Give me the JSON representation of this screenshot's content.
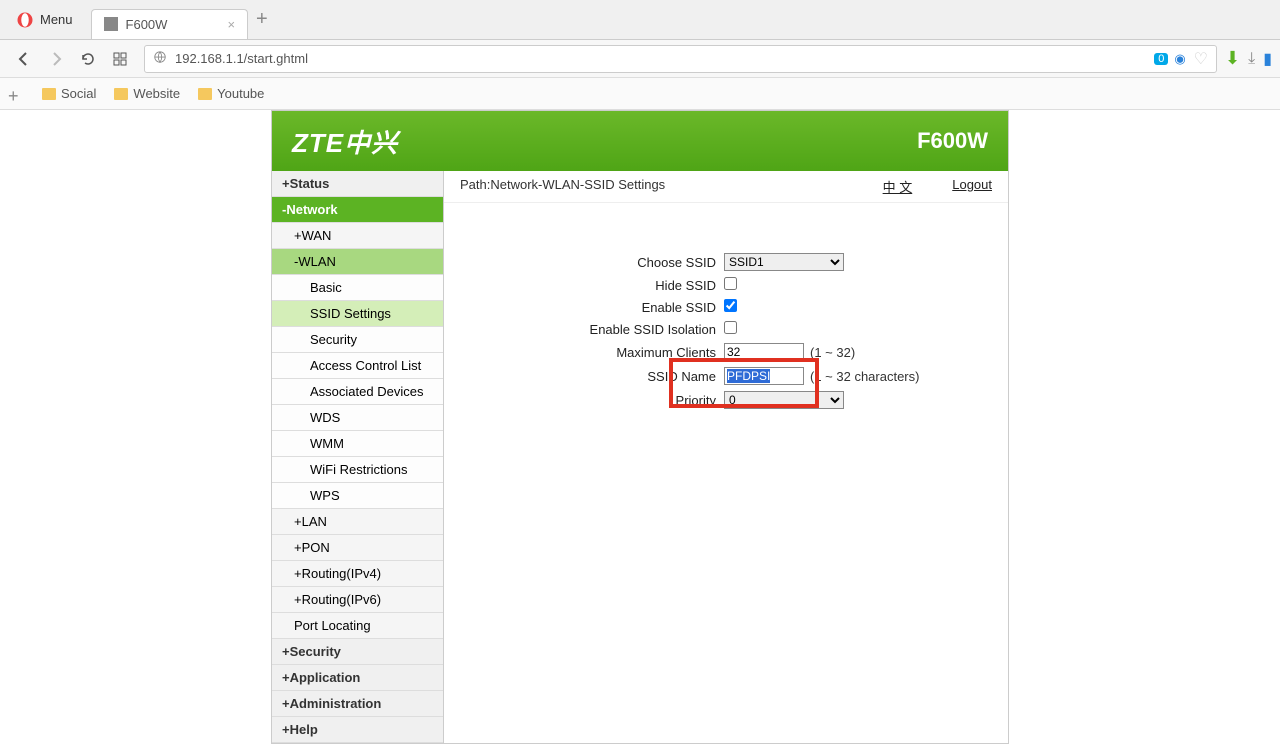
{
  "browser": {
    "menu_label": "Menu",
    "tab_title": "F600W",
    "url": "192.168.1.1/start.ghtml",
    "badge_count": "0",
    "bookmarks": [
      "Social",
      "Website",
      "Youtube"
    ]
  },
  "router": {
    "logo": "ZTE中兴",
    "model": "F600W",
    "path": "Path:Network-WLAN-SSID Settings",
    "lang_link": "中 文",
    "logout": "Logout"
  },
  "sidebar": {
    "status": "+Status",
    "network": "-Network",
    "wan": "+WAN",
    "wlan": "-WLAN",
    "wlan_items": [
      "Basic",
      "SSID Settings",
      "Security",
      "Access Control List",
      "Associated Devices",
      "WDS",
      "WMM",
      "WiFi Restrictions",
      "WPS"
    ],
    "lan": "+LAN",
    "pon": "+PON",
    "routing4": "+Routing(IPv4)",
    "routing6": "+Routing(IPv6)",
    "port_locating": "Port Locating",
    "security": "+Security",
    "application": "+Application",
    "administration": "+Administration",
    "help": "+Help"
  },
  "form": {
    "choose_ssid_label": "Choose SSID",
    "choose_ssid_value": "SSID1",
    "hide_ssid_label": "Hide SSID",
    "enable_ssid_label": "Enable SSID",
    "enable_isolation_label": "Enable SSID Isolation",
    "max_clients_label": "Maximum Clients",
    "max_clients_value": "32",
    "max_clients_hint": "(1 ~ 32)",
    "ssid_name_label": "SSID Name",
    "ssid_name_value": "PFDPSI",
    "ssid_name_hint": "(1 ~ 32 characters)",
    "priority_label": "Priority",
    "priority_value": "0"
  }
}
